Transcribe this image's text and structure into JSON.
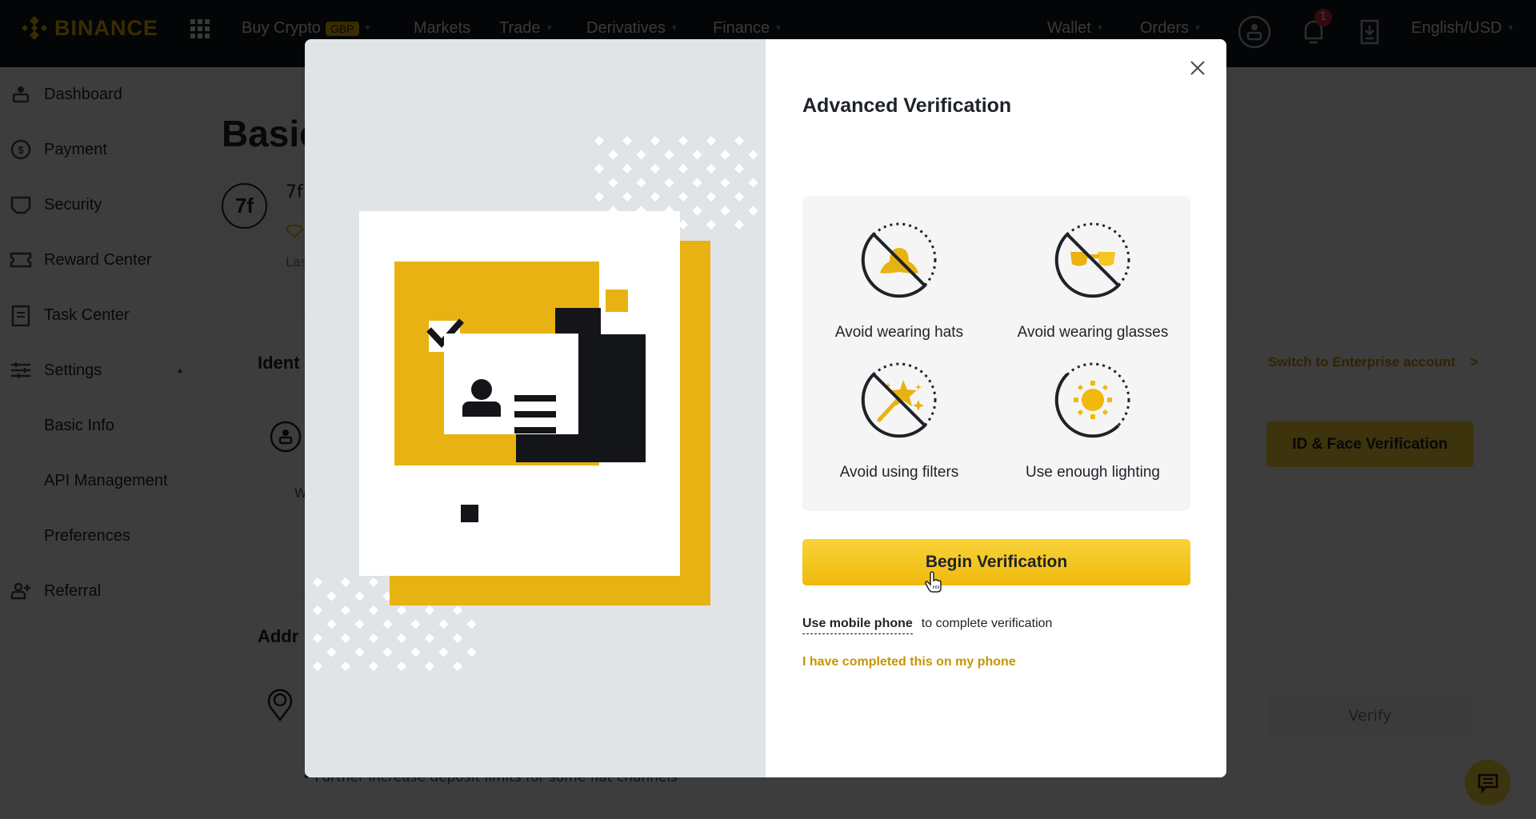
{
  "topnav": {
    "logo": "BINANCE",
    "items": [
      {
        "label": "Buy Crypto",
        "badge": "GBP",
        "has_caret": true
      },
      {
        "label": "Markets",
        "has_caret": false
      },
      {
        "label": "Trade",
        "has_caret": true
      },
      {
        "label": "Derivatives",
        "has_caret": true
      },
      {
        "label": "Finance",
        "has_caret": true
      }
    ],
    "right_items": [
      {
        "label": "Wallet",
        "has_caret": true
      },
      {
        "label": "Orders",
        "has_caret": true
      }
    ],
    "notification_count": "1",
    "language": "English/USD",
    "caret": "▼"
  },
  "sidebar": {
    "items": [
      {
        "label": "Dashboard",
        "icon": "user-icon"
      },
      {
        "label": "Payment",
        "icon": "dollar-icon"
      },
      {
        "label": "Security",
        "icon": "shield-icon"
      },
      {
        "label": "Reward Center",
        "icon": "ticket-icon"
      },
      {
        "label": "Task Center",
        "icon": "clipboard-icon"
      },
      {
        "label": "Settings",
        "icon": "sliders-icon",
        "expanded": true
      },
      {
        "label": "Basic Info",
        "sub": true
      },
      {
        "label": "API Management",
        "sub": true
      },
      {
        "label": "Preferences",
        "sub": true
      },
      {
        "label": "Referral",
        "icon": "add-user-icon"
      }
    ],
    "collapse_glyph": "▲"
  },
  "background": {
    "title": "Basic Info",
    "avatar_initials": "7f",
    "username": "7f",
    "last_login": "Las",
    "identity_heading": "Ident",
    "enterprise_link": "Switch to Enterprise account",
    "enterprise_chevron": ">",
    "id_face_button": "ID & Face Verification",
    "identity_text_fragment": "W",
    "address_heading": "Addr",
    "verify_button": "Verify",
    "address_bullet": "• Further increase deposit limits for some fiat channels"
  },
  "modal": {
    "title": "Advanced Verification",
    "close_glyph": "✕",
    "tips": [
      {
        "label": "Avoid wearing hats",
        "icon": "no-hat-icon"
      },
      {
        "label": "Avoid wearing glasses",
        "icon": "no-glasses-icon"
      },
      {
        "label": "Avoid using filters",
        "icon": "no-filter-icon"
      },
      {
        "label": "Use enough lighting",
        "icon": "sun-icon"
      }
    ],
    "begin_button": "Begin Verification",
    "mobile_link": "Use mobile phone",
    "mobile_suffix": "to complete verification",
    "completed_link": "I have completed this on my phone"
  },
  "colors": {
    "brand_yellow": "#f0b90b",
    "nav_bg": "#12161c",
    "link_gold": "#c99400",
    "notification_red": "#cf304a"
  }
}
